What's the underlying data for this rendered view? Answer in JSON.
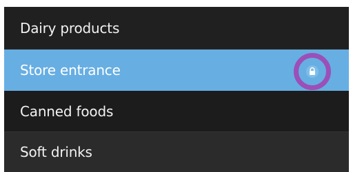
{
  "list": {
    "items": [
      {
        "label": "Dairy products"
      },
      {
        "label": "Store entrance",
        "selected": true,
        "icon": "lock-icon"
      },
      {
        "label": "Canned foods"
      },
      {
        "label": "Soft drinks"
      }
    ]
  },
  "colors": {
    "panel_background": "#1f1f1f",
    "selected_background": "#67aee3",
    "highlight_ring": "#9b4fb8",
    "text": "#f2f2f2"
  }
}
